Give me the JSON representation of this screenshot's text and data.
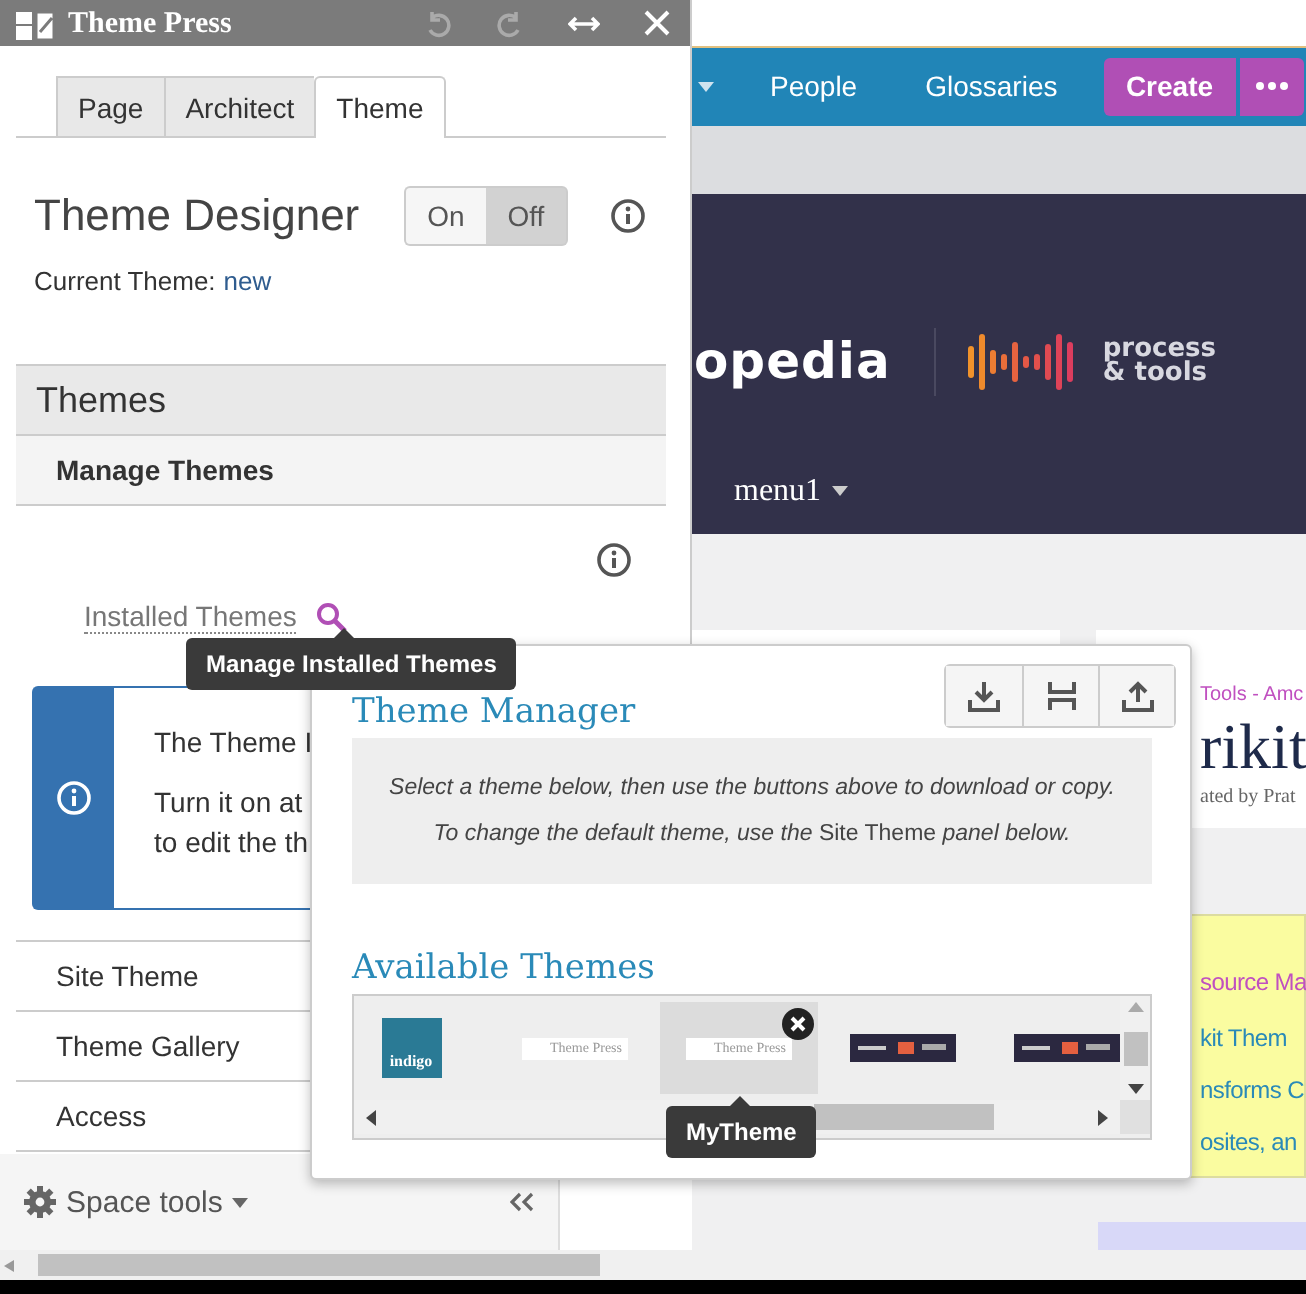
{
  "toolbar": {
    "title": "Theme Press"
  },
  "tabs": [
    {
      "label": "Page",
      "selected": false
    },
    {
      "label": "Architect",
      "selected": false
    },
    {
      "label": "Theme",
      "selected": true
    }
  ],
  "designer": {
    "title": "Theme Designer",
    "toggle": [
      {
        "label": "On",
        "selected": false
      },
      {
        "label": "Off",
        "selected": true
      }
    ],
    "current_label": "Current Theme:",
    "current_value": "new"
  },
  "section": {
    "title": "Themes",
    "subsection": "Manage Themes"
  },
  "installed": {
    "label": "Installed Themes",
    "tooltip": "Manage Installed Themes"
  },
  "info_box": {
    "lines": [
      "The Theme I",
      "Turn it on at",
      "to edit the th"
    ]
  },
  "menu": [
    "Site Theme",
    "Theme Gallery",
    "Access"
  ],
  "space_tools": "Space tools",
  "nav": {
    "items": [
      "People",
      "Glossaries"
    ],
    "create": "Create"
  },
  "banner": {
    "logo_text": "opedia",
    "brand_line1": "process",
    "brand_line2": "& tools",
    "menu": "menu1"
  },
  "content": {
    "breadcrumb": "Tools - Amc",
    "title": "rikit",
    "byline": "ated by Prat",
    "note_title": "source Ma",
    "note_lines": [
      "kit Them",
      "nsforms C",
      "osites, an"
    ]
  },
  "theme_manager": {
    "title": "Theme Manager",
    "hints": [
      "*Select a theme below, then use the buttons above to download or copy.*",
      "*To change the default theme, use the* Site Theme *panel below.*"
    ],
    "available_title": "Available Themes",
    "themes": [
      {
        "kind": "tile",
        "label": "indigo",
        "selected": false
      },
      {
        "kind": "logo",
        "label": "Theme Press",
        "selected": false
      },
      {
        "kind": "logo",
        "label": "Theme Press",
        "selected": true
      },
      {
        "kind": "dark",
        "selected": false
      },
      {
        "kind": "dark",
        "selected": false
      }
    ],
    "tooltip": "MyTheme"
  }
}
